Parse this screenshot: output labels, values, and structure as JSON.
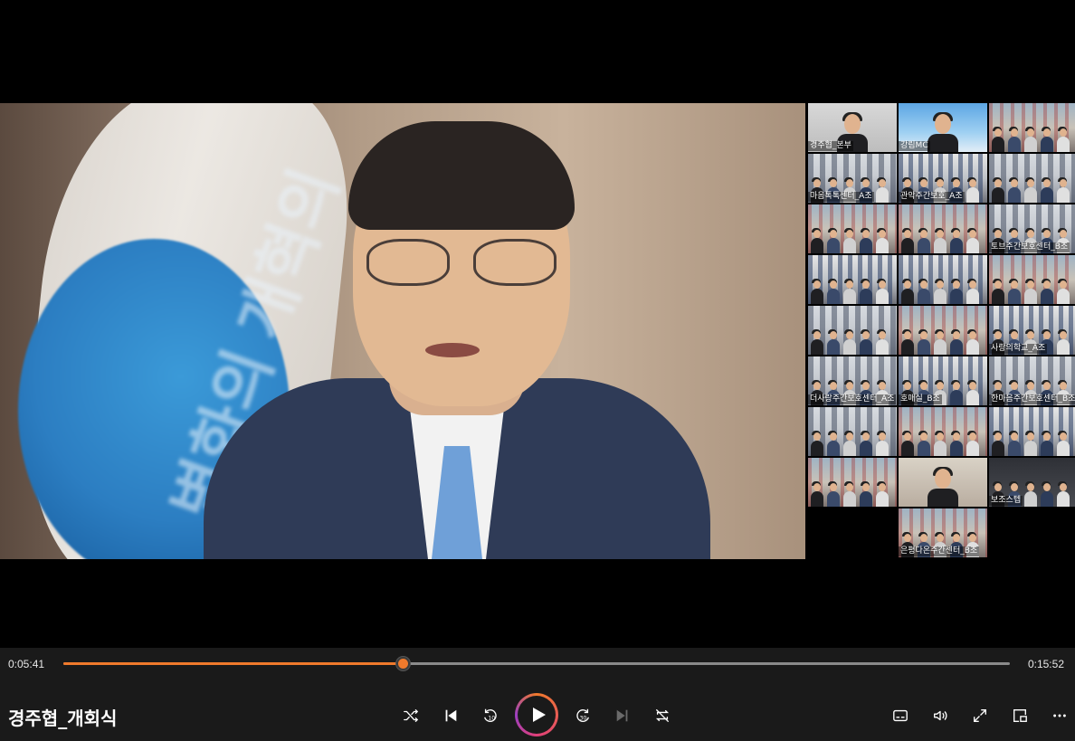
{
  "player": {
    "title": "경주협_개회식",
    "time_current": "0:05:41",
    "time_total": "0:15:52",
    "progress": 0.3582,
    "accent_color": "#f07a2c"
  },
  "video": {
    "flag_text": "변화의 개혁의"
  },
  "participants": [
    {
      "label": "경주협_본부",
      "bg": "bg-person"
    },
    {
      "label": "강림MC",
      "bg": "bg-mc"
    },
    {
      "label": "",
      "bg": "bg-room3"
    },
    {
      "label": "마음톡톡센터_A조",
      "bg": "bg-room"
    },
    {
      "label": "관악주간보호_A조",
      "bg": "bg-room2"
    },
    {
      "label": "",
      "bg": "bg-room"
    },
    {
      "label": "",
      "bg": "bg-room3"
    },
    {
      "label": "",
      "bg": "bg-room3"
    },
    {
      "label": "토브주간보호센터_B조",
      "bg": "bg-room"
    },
    {
      "label": "",
      "bg": "bg-room2"
    },
    {
      "label": "",
      "bg": "bg-room2"
    },
    {
      "label": "",
      "bg": "bg-room3"
    },
    {
      "label": "",
      "bg": "bg-room"
    },
    {
      "label": "",
      "bg": "bg-room3"
    },
    {
      "label": "사랑의학교_A조",
      "bg": "bg-room2"
    },
    {
      "label": "더사랑주간보호센터_A조",
      "bg": "bg-room"
    },
    {
      "label": "호매실_B조",
      "bg": "bg-room2"
    },
    {
      "label": "한마음주간보호센터_B조",
      "bg": "bg-room"
    },
    {
      "label": "",
      "bg": "bg-room"
    },
    {
      "label": "",
      "bg": "bg-room3"
    },
    {
      "label": "",
      "bg": "bg-room2"
    },
    {
      "label": "",
      "bg": "bg-room3"
    },
    {
      "label": "",
      "bg": "bg-woman"
    },
    {
      "label": "보조스텝",
      "bg": "bg-cartoon"
    },
    {
      "label": "은평다온주간센터_B조",
      "bg": "bg-room3"
    }
  ],
  "controls": {
    "shuffle": "shuffle-icon",
    "previous": "previous-icon",
    "rewind": "rewind-10-icon",
    "play": "play-icon",
    "forward": "forward-30-icon",
    "next": "next-icon",
    "repeat": "repeat-off-icon",
    "subtitles": "subtitles-icon",
    "volume": "volume-icon",
    "fullscreen": "fullscreen-icon",
    "miniplayer": "miniplayer-icon",
    "more": "more-icon",
    "rewind_label": "10",
    "forward_label": "30"
  }
}
